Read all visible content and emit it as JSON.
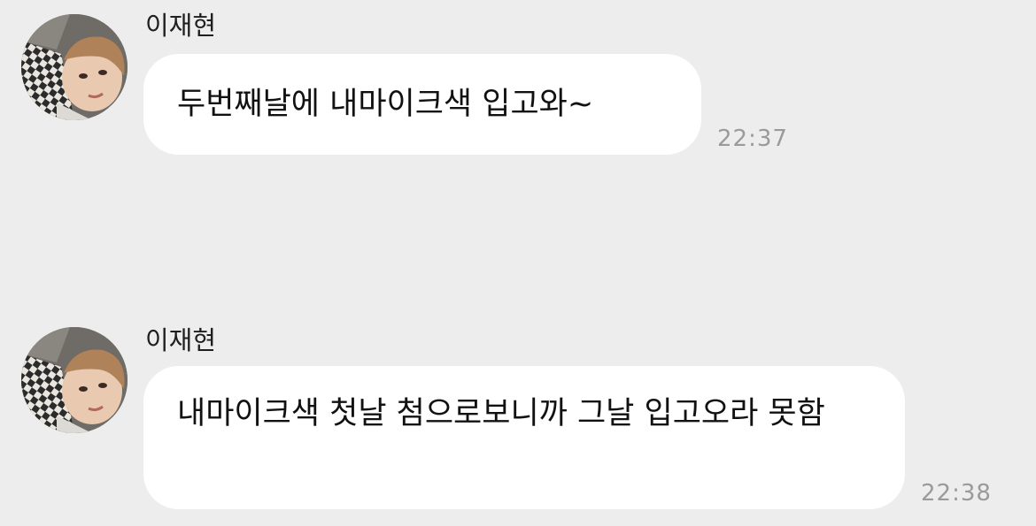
{
  "messages": [
    {
      "sender": "이재현",
      "text": "두번째날에 내마이크색 입고와~",
      "time": "22:37"
    },
    {
      "sender": "이재현",
      "text": "내마이크색 첫날 첨으로보니까 그날 입고오라 못함",
      "time": "22:38"
    }
  ],
  "colors": {
    "background": "#ededed",
    "bubble": "#ffffff",
    "text": "#111111",
    "timestamp": "#9a9a9a"
  }
}
